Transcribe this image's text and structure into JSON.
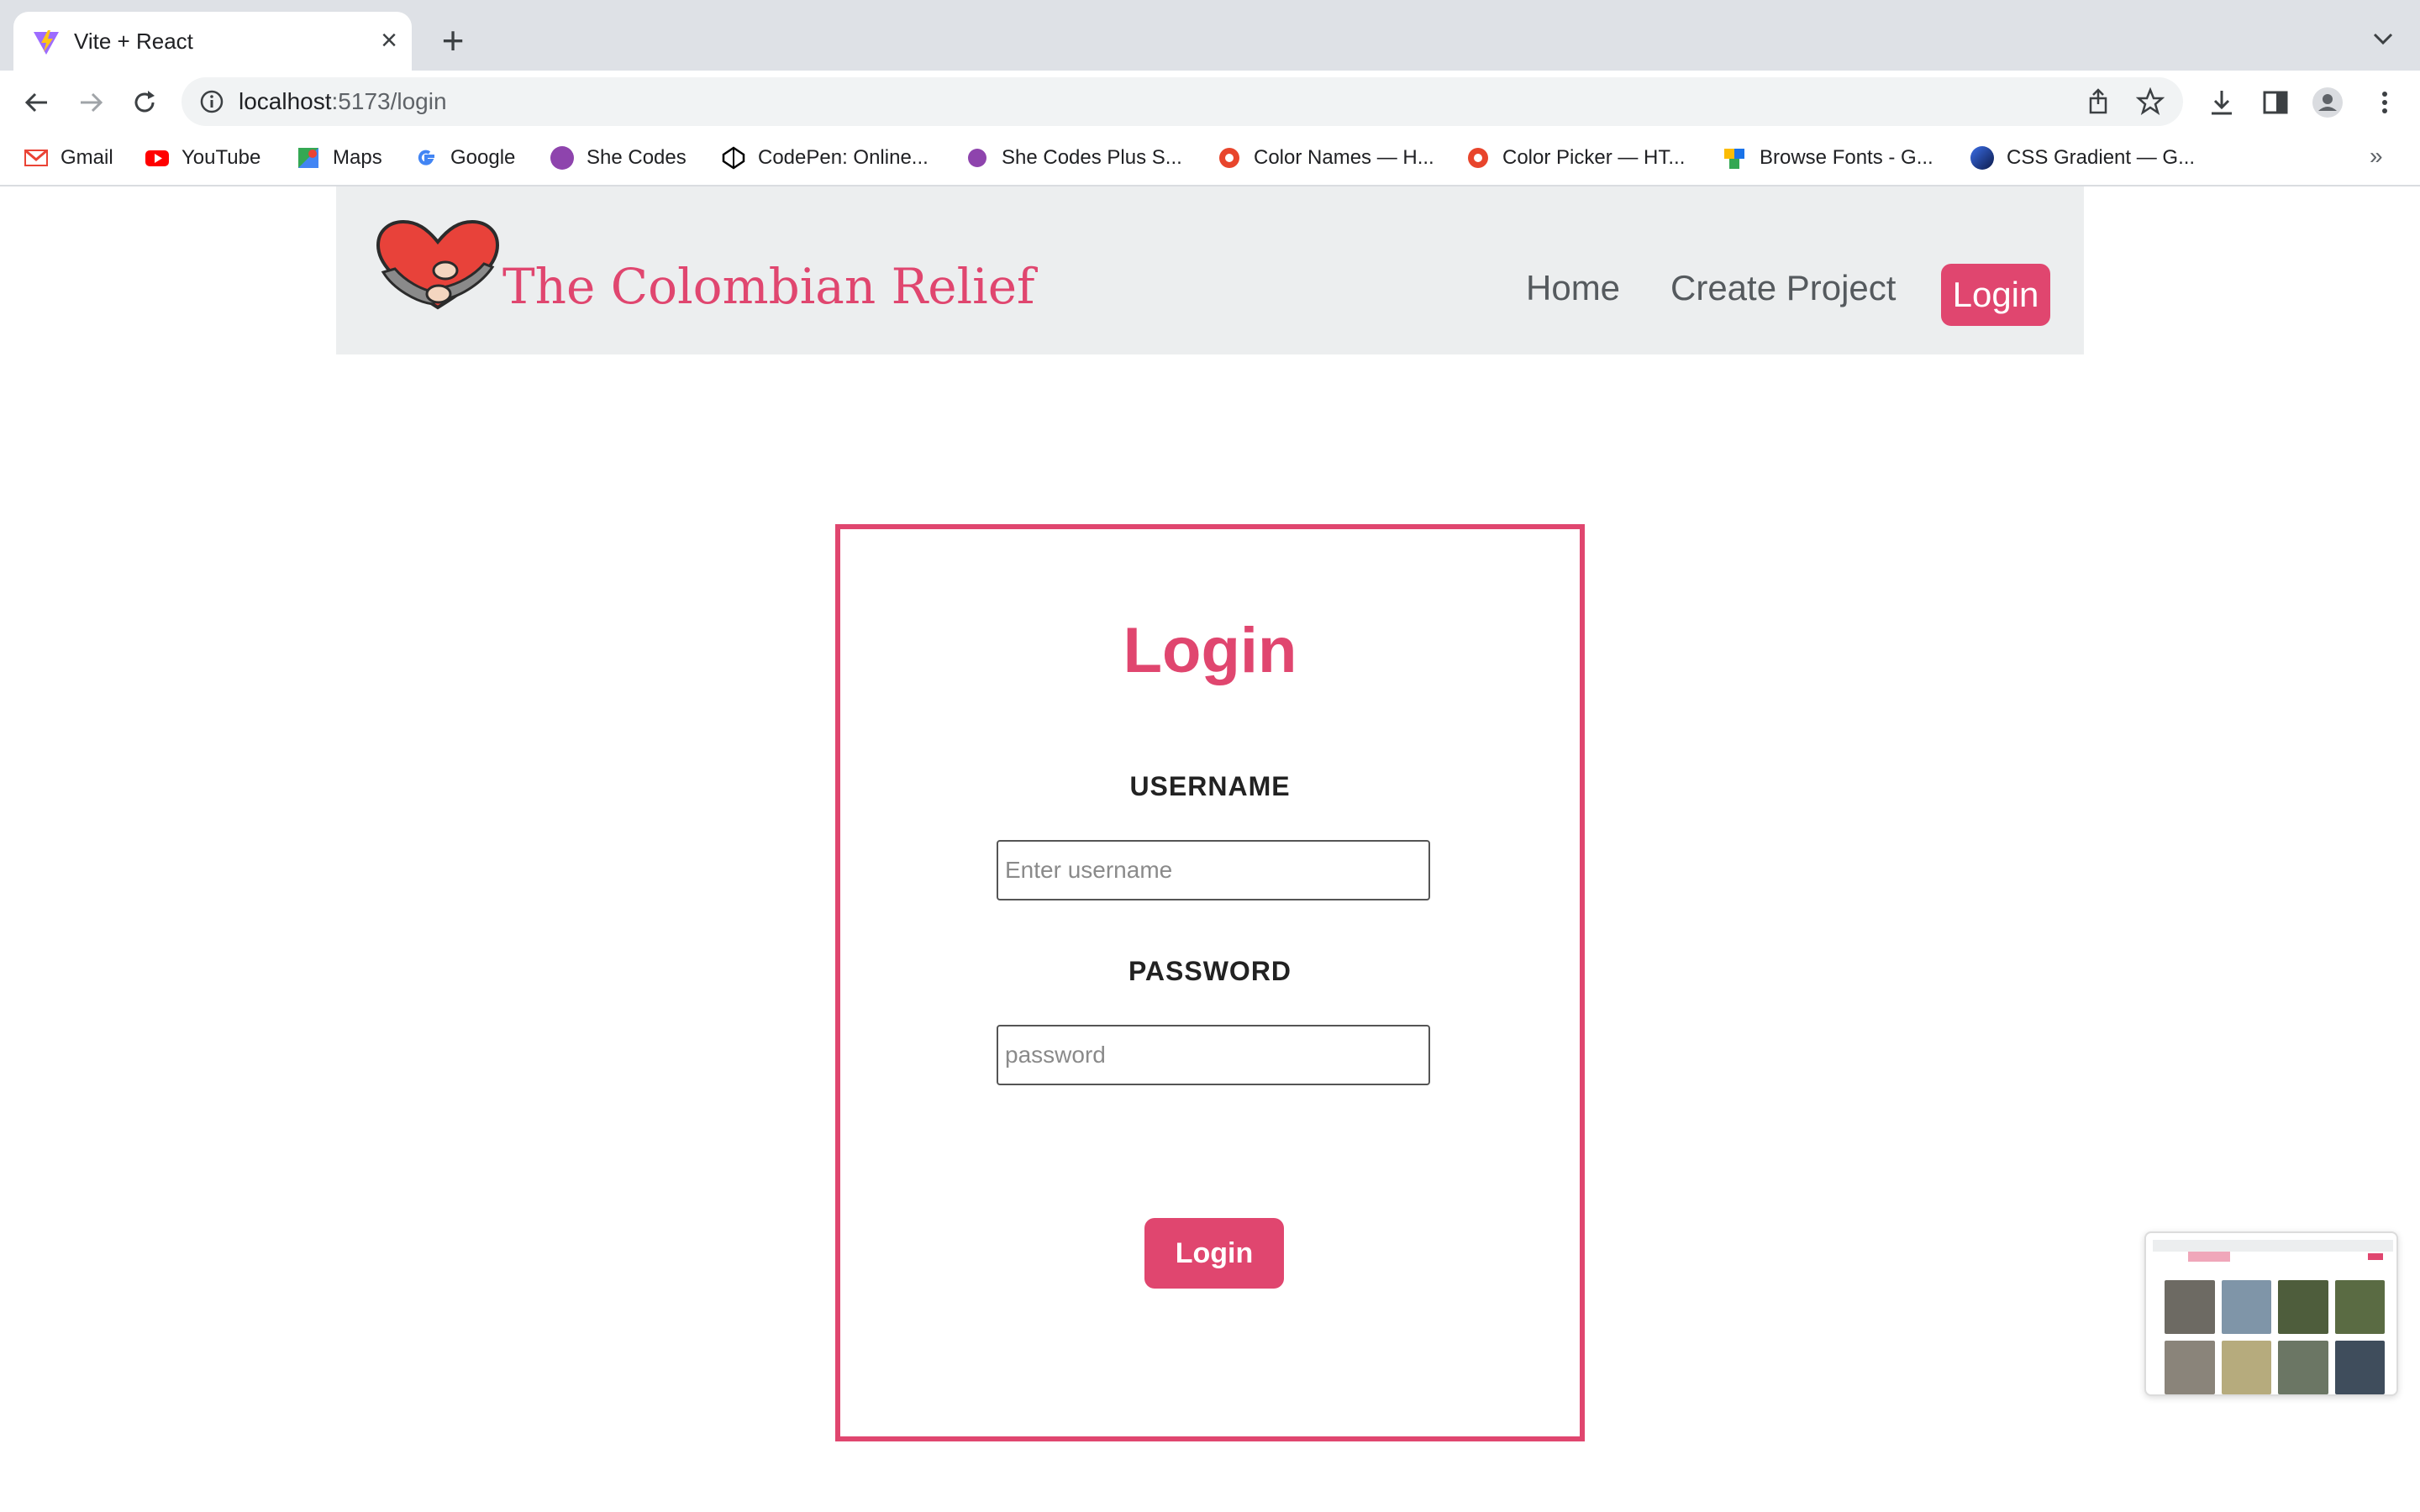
{
  "browser": {
    "tab_title": "Vite + React",
    "url_host": "localhost",
    "url_path": ":5173/login",
    "bookmarks": [
      {
        "label": "Gmail",
        "icon": "gmail-icon",
        "color": "#ea4335"
      },
      {
        "label": "YouTube",
        "icon": "youtube-icon",
        "color": "#ff0000"
      },
      {
        "label": "Maps",
        "icon": "maps-icon",
        "color": "#34a853"
      },
      {
        "label": "Google",
        "icon": "google-icon",
        "color": "#4285f4"
      },
      {
        "label": "She Codes",
        "icon": "shecodes-icon",
        "color": "#8e44ad"
      },
      {
        "label": "CodePen: Online...",
        "icon": "codepen-icon",
        "color": "#000000"
      },
      {
        "label": "She Codes Plus S...",
        "icon": "shecodes-icon",
        "color": "#8e44ad"
      },
      {
        "label": "Color Names — H...",
        "icon": "colorpicker-icon",
        "color": "#e8452c"
      },
      {
        "label": "Color Picker — HT...",
        "icon": "colorpicker-icon",
        "color": "#e8452c"
      },
      {
        "label": "Browse Fonts - G...",
        "icon": "google-fonts-icon",
        "color": "#1a73e8"
      },
      {
        "label": "CSS Gradient — G...",
        "icon": "cssgradient-icon",
        "color": "#1b3a8a"
      }
    ],
    "more_label": "»"
  },
  "site": {
    "brand": "The Colombian Relief",
    "nav": {
      "home": "Home",
      "create_project": "Create Project",
      "login": "Login"
    },
    "accent_color": "#e0466f"
  },
  "login_form": {
    "title": "Login",
    "username_label": "USERNAME",
    "username_placeholder": "Enter username",
    "password_label": "PASSWORD",
    "password_placeholder": "password",
    "submit_label": "Login"
  }
}
